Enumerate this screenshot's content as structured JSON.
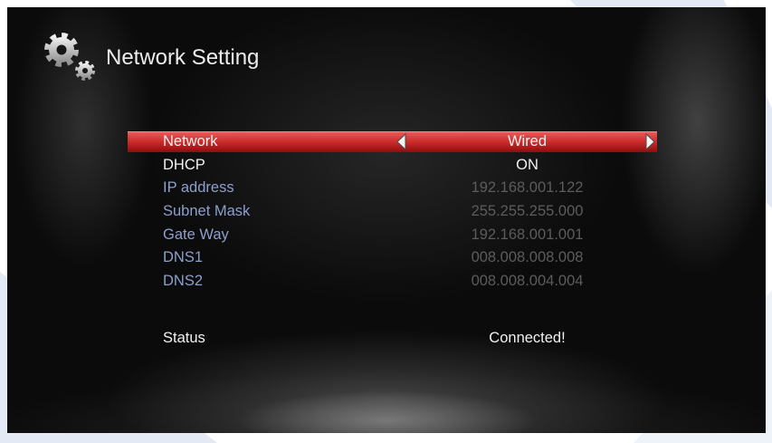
{
  "screen": {
    "title": "Network Setting",
    "title_icon": "gears-icon"
  },
  "settings": [
    {
      "label": "Network",
      "value": "Wired",
      "state": "selected",
      "prev_icon": "arrow-left-icon",
      "next_icon": "arrow-right-icon"
    },
    {
      "label": "DHCP",
      "value": "ON",
      "state": "enabled"
    },
    {
      "label": "IP address",
      "value": "192.168.001.122",
      "state": "disabled"
    },
    {
      "label": "Subnet Mask",
      "value": "255.255.255.000",
      "state": "disabled"
    },
    {
      "label": "Gate Way",
      "value": "192.168.001.001",
      "state": "disabled"
    },
    {
      "label": "DNS1",
      "value": "008.008.008.008",
      "state": "disabled"
    },
    {
      "label": "DNS2",
      "value": "008.008.004.004",
      "state": "disabled"
    }
  ],
  "status": {
    "label": "Status",
    "value": "Connected!"
  },
  "colors": {
    "highlight": "#c8282a",
    "text": "#f2f2f2",
    "disabled_label": "#8d9fcf",
    "disabled_value": "#5c5c5c",
    "background": "#0b0b0b",
    "frame": "#ffffff"
  }
}
